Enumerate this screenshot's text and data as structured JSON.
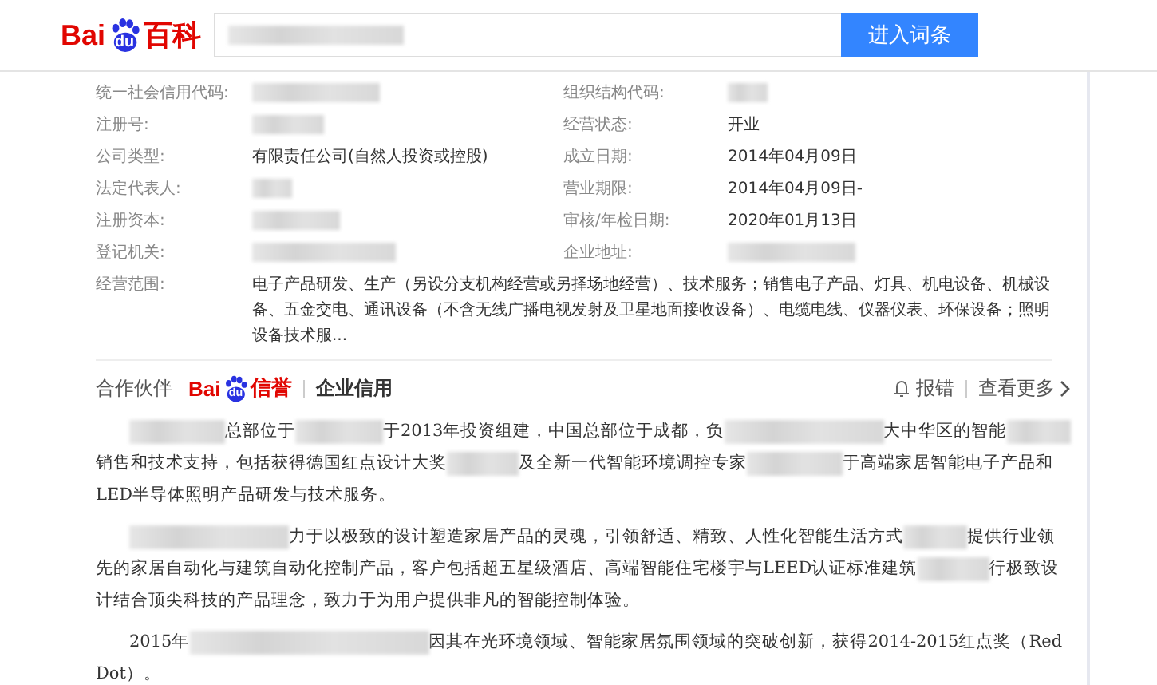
{
  "header": {
    "logo": {
      "brand": "Bai",
      "paw": "du",
      "product": "百科"
    },
    "search": {
      "kind": "redacted"
    },
    "button": "进入词条"
  },
  "info": {
    "rows": [
      {
        "left": {
          "label": "统一社会信用代码:",
          "kind": "redacted"
        },
        "right": {
          "label": "组织结构代码:",
          "kind": "redacted"
        }
      },
      {
        "left": {
          "label": "注册号:",
          "kind": "redacted"
        },
        "right": {
          "label": "经营状态:",
          "kind": "text",
          "value": "开业"
        }
      },
      {
        "left": {
          "label": "公司类型:",
          "kind": "text",
          "value": "有限责任公司(自然人投资或控股)"
        },
        "right": {
          "label": "成立日期:",
          "kind": "text",
          "value": "2014年04月09日"
        }
      },
      {
        "left": {
          "label": "法定代表人:",
          "kind": "redacted"
        },
        "right": {
          "label": "营业期限:",
          "kind": "text",
          "value": "2014年04月09日-"
        }
      },
      {
        "left": {
          "label": "注册资本:",
          "kind": "redacted"
        },
        "right": {
          "label": "审核/年检日期:",
          "kind": "text",
          "value": "2020年01月13日"
        }
      },
      {
        "left": {
          "label": "登记机关:",
          "kind": "redacted"
        },
        "right": {
          "label": "企业地址:",
          "kind": "redacted"
        }
      }
    ],
    "scope": {
      "label": "经营范围:",
      "value": "电子产品研发、生产（另设分支机构经营或另择场地经营）、技术服务；销售电子产品、灯具、机电设备、机械设备、五金交电、通讯设备（不含无线广播电视发射及卫星地面接收设备）、电缆电线、仪器仪表、环保设备；照明设备技术服..."
    }
  },
  "partner": {
    "label": "合作伙伴",
    "logo": {
      "brand": "Bai",
      "paw": "du",
      "product": "信誉"
    },
    "service": "企业信用",
    "report": "报错",
    "more": "查看更多"
  },
  "paragraphs": [
    [
      {
        "kind": "redacted"
      },
      {
        "kind": "text",
        "text": "总部位于"
      },
      {
        "kind": "redacted"
      },
      {
        "kind": "text",
        "text": "于2013年投资组建，中国总部位于成都，负"
      },
      {
        "kind": "redacted"
      },
      {
        "kind": "text",
        "text": "大中华区的智能"
      },
      {
        "kind": "redacted"
      },
      {
        "kind": "text",
        "text": "销售和技术支持，包括获得德国红点设计大奖"
      },
      {
        "kind": "redacted"
      },
      {
        "kind": "text",
        "text": "及全新一代智能环境调控专家"
      },
      {
        "kind": "redacted"
      },
      {
        "kind": "text",
        "text": "于高端家居智能电子产品和LED半导体照明产品研发与技术服务。"
      }
    ],
    [
      {
        "kind": "redacted"
      },
      {
        "kind": "text",
        "text": "力于以极致的设计塑造家居产品的灵魂，引领舒适、精致、人性化智能生活方式"
      },
      {
        "kind": "redacted"
      },
      {
        "kind": "text",
        "text": "提供行业领先的家居自动化与建筑自动化控制产品，客户包括超五星级酒店、高端智能住宅楼宇与LEED认证标准建筑"
      },
      {
        "kind": "redacted"
      },
      {
        "kind": "text",
        "text": "行极致设计结合顶尖科技的产品理念，致力于为用户提供非凡的智能控制体验。"
      }
    ],
    [
      {
        "kind": "text",
        "text": "2015年"
      },
      {
        "kind": "redacted"
      },
      {
        "kind": "text",
        "text": "因其在光环境领域、智能家居氛围领域的突破创新，获得2014-2015红点奖（Red Dot）。"
      }
    ]
  ]
}
